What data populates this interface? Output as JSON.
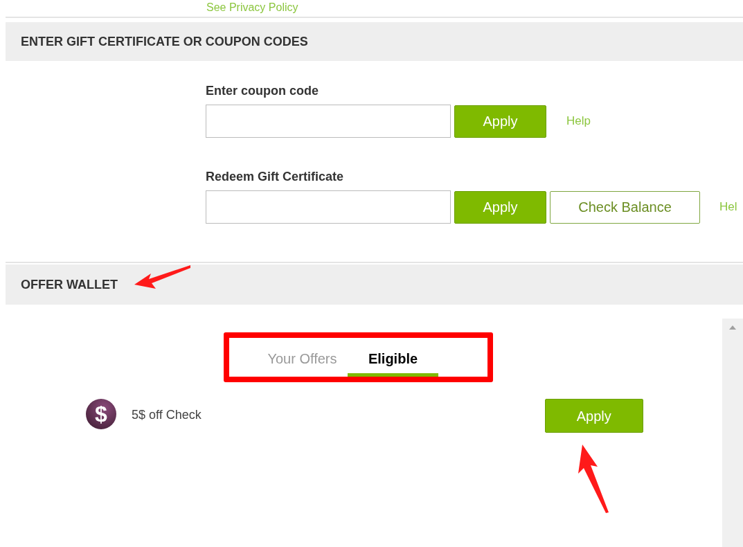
{
  "privacy_link": "See Privacy Policy",
  "coupon_section": {
    "title": "ENTER GIFT CERTIFICATE OR COUPON CODES",
    "coupon": {
      "label": "Enter coupon code",
      "apply": "Apply",
      "help": "Help"
    },
    "gift": {
      "label": "Redeem Gift Certificate",
      "apply": "Apply",
      "check_balance": "Check Balance",
      "help": "Hel"
    }
  },
  "offer_wallet": {
    "title": "OFFER WALLET",
    "tabs": [
      {
        "label": "Your Offers",
        "selected": false
      },
      {
        "label": "Eligible",
        "selected": true
      }
    ],
    "offers": [
      {
        "icon": "$",
        "title": "5$ off Check",
        "action": "Apply"
      }
    ]
  }
}
